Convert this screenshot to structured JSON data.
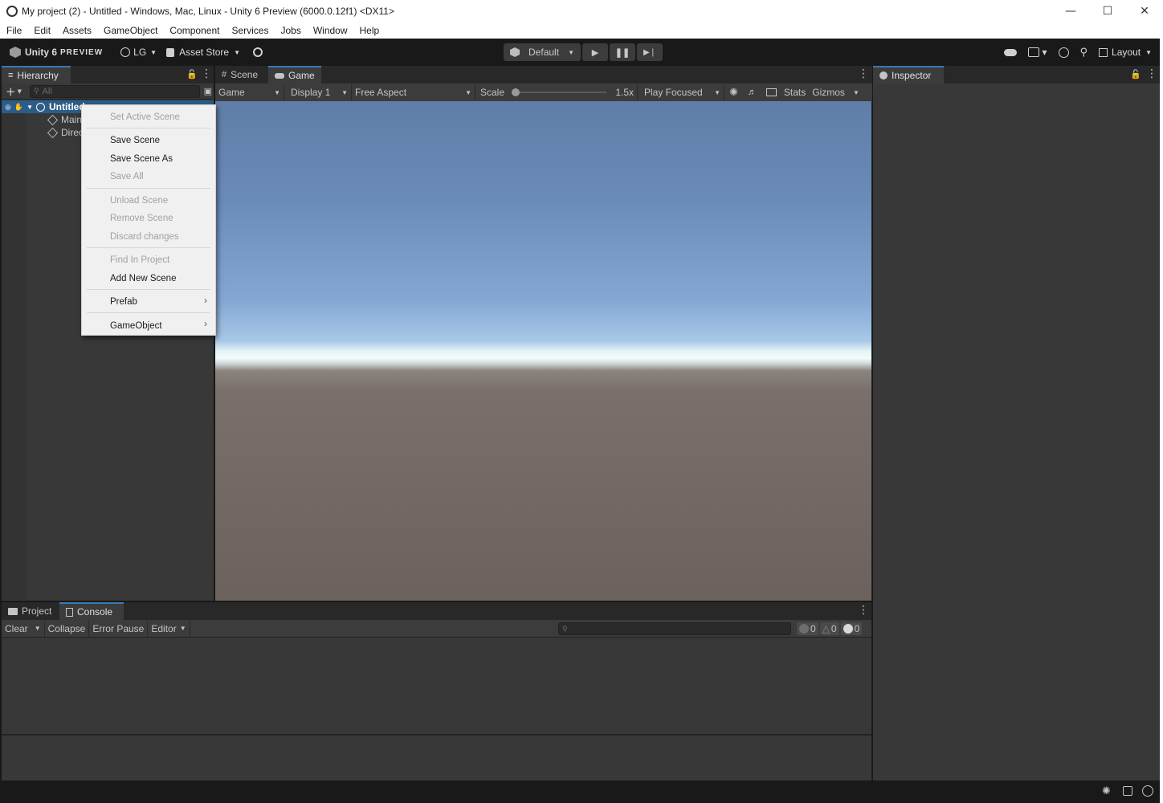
{
  "window": {
    "title": "My project (2) - Untitled - Windows, Mac, Linux - Unity 6 Preview (6000.0.12f1) <DX11>"
  },
  "menu": [
    "File",
    "Edit",
    "Assets",
    "GameObject",
    "Component",
    "Services",
    "Jobs",
    "Window",
    "Help"
  ],
  "toolbar": {
    "logo": "Unity 6",
    "logo_suffix": "PREVIEW",
    "account": "LG",
    "asset_store": "Asset Store",
    "default_label": "Default",
    "layout_label": "Layout"
  },
  "hierarchy": {
    "tab_label": "Hierarchy",
    "search_placeholder": "All",
    "scene_name": "Untitled",
    "children": [
      "Main",
      "Direc"
    ]
  },
  "game_view": {
    "tabs": [
      "Scene",
      "Game"
    ],
    "mode": "Game",
    "display": "Display 1",
    "aspect": "Free Aspect",
    "scale_label": "Scale",
    "scale_value": "1.5x",
    "play_mode": "Play Focused",
    "stats": "Stats",
    "gizmos": "Gizmos"
  },
  "context_menu": {
    "set_active_scene": "Set Active Scene",
    "save_scene": "Save Scene",
    "save_scene_as": "Save Scene As",
    "save_all": "Save All",
    "unload_scene": "Unload Scene",
    "remove_scene": "Remove Scene",
    "discard_changes": "Discard changes",
    "find_in_project": "Find In Project",
    "add_new_scene": "Add New Scene",
    "prefab": "Prefab",
    "gameobject": "GameObject"
  },
  "inspector": {
    "tab_label": "Inspector"
  },
  "bottom": {
    "tabs": [
      "Project",
      "Console"
    ],
    "clear": "Clear",
    "collapse": "Collapse",
    "error_pause": "Error Pause",
    "editor": "Editor",
    "log_count": "0",
    "warn_count": "0",
    "error_count": "0"
  },
  "colors": {
    "selection": "#2c5d87",
    "tab_accent": "#3a79bb",
    "panel_bg": "#383838",
    "editor_bg": "#191919"
  }
}
